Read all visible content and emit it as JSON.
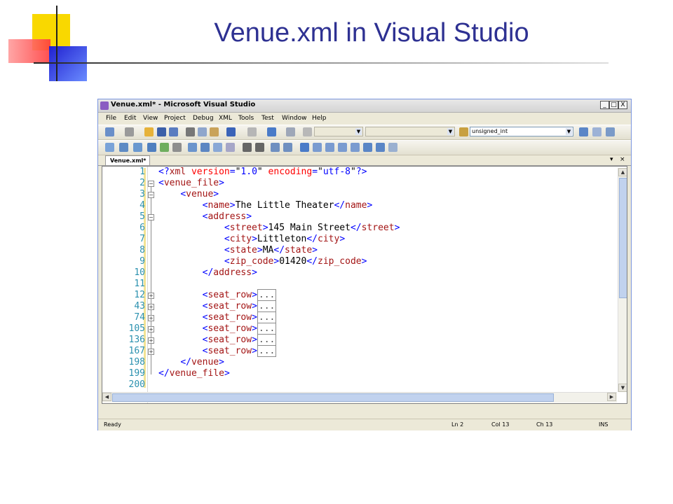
{
  "slide": {
    "title": "Venue.xml in Visual Studio"
  },
  "window": {
    "title": "Venue.xml* - Microsoft Visual Studio",
    "controls": {
      "minimize": "_",
      "maximize": "□",
      "close": "X"
    }
  },
  "menu": [
    "File",
    "Edit",
    "View",
    "Project",
    "Debug",
    "XML",
    "Tools",
    "Test",
    "Window",
    "Help"
  ],
  "toolbar": {
    "type_combo": "unsigned_int"
  },
  "tab": {
    "label": "Venue.xml*",
    "dropdown": "▾",
    "close": "×"
  },
  "editor": {
    "line_numbers": [
      "1",
      "2",
      "3",
      "4",
      "5",
      "6",
      "7",
      "8",
      "9",
      "10",
      "11",
      "12",
      "43",
      "74",
      "105",
      "136",
      "167",
      "198",
      "199",
      "200"
    ],
    "collapsed_marker": "...",
    "code": {
      "l1_open": "<?",
      "l1_tag": "xml",
      "l1_attr1": " version",
      "l1_eq": "=",
      "l1_val1": "\"1.0\"",
      "l1_attr2": " encoding",
      "l1_val2": "\"utf-8\"",
      "l1_close": "?>",
      "venue_file": "venue_file",
      "venue": "venue",
      "name": "name",
      "name_value": "The Little Theater",
      "address": "address",
      "street": "street",
      "street_value": "145 Main Street",
      "city": "city",
      "city_value": "Littleton",
      "state": "state",
      "state_value": "MA",
      "zip_code": "zip_code",
      "zip_value": "01420",
      "seat_row": "seat_row"
    }
  },
  "status": {
    "ready": "Ready",
    "ln": "Ln 2",
    "col": "Col 13",
    "ch": "Ch 13",
    "mode": "INS"
  }
}
